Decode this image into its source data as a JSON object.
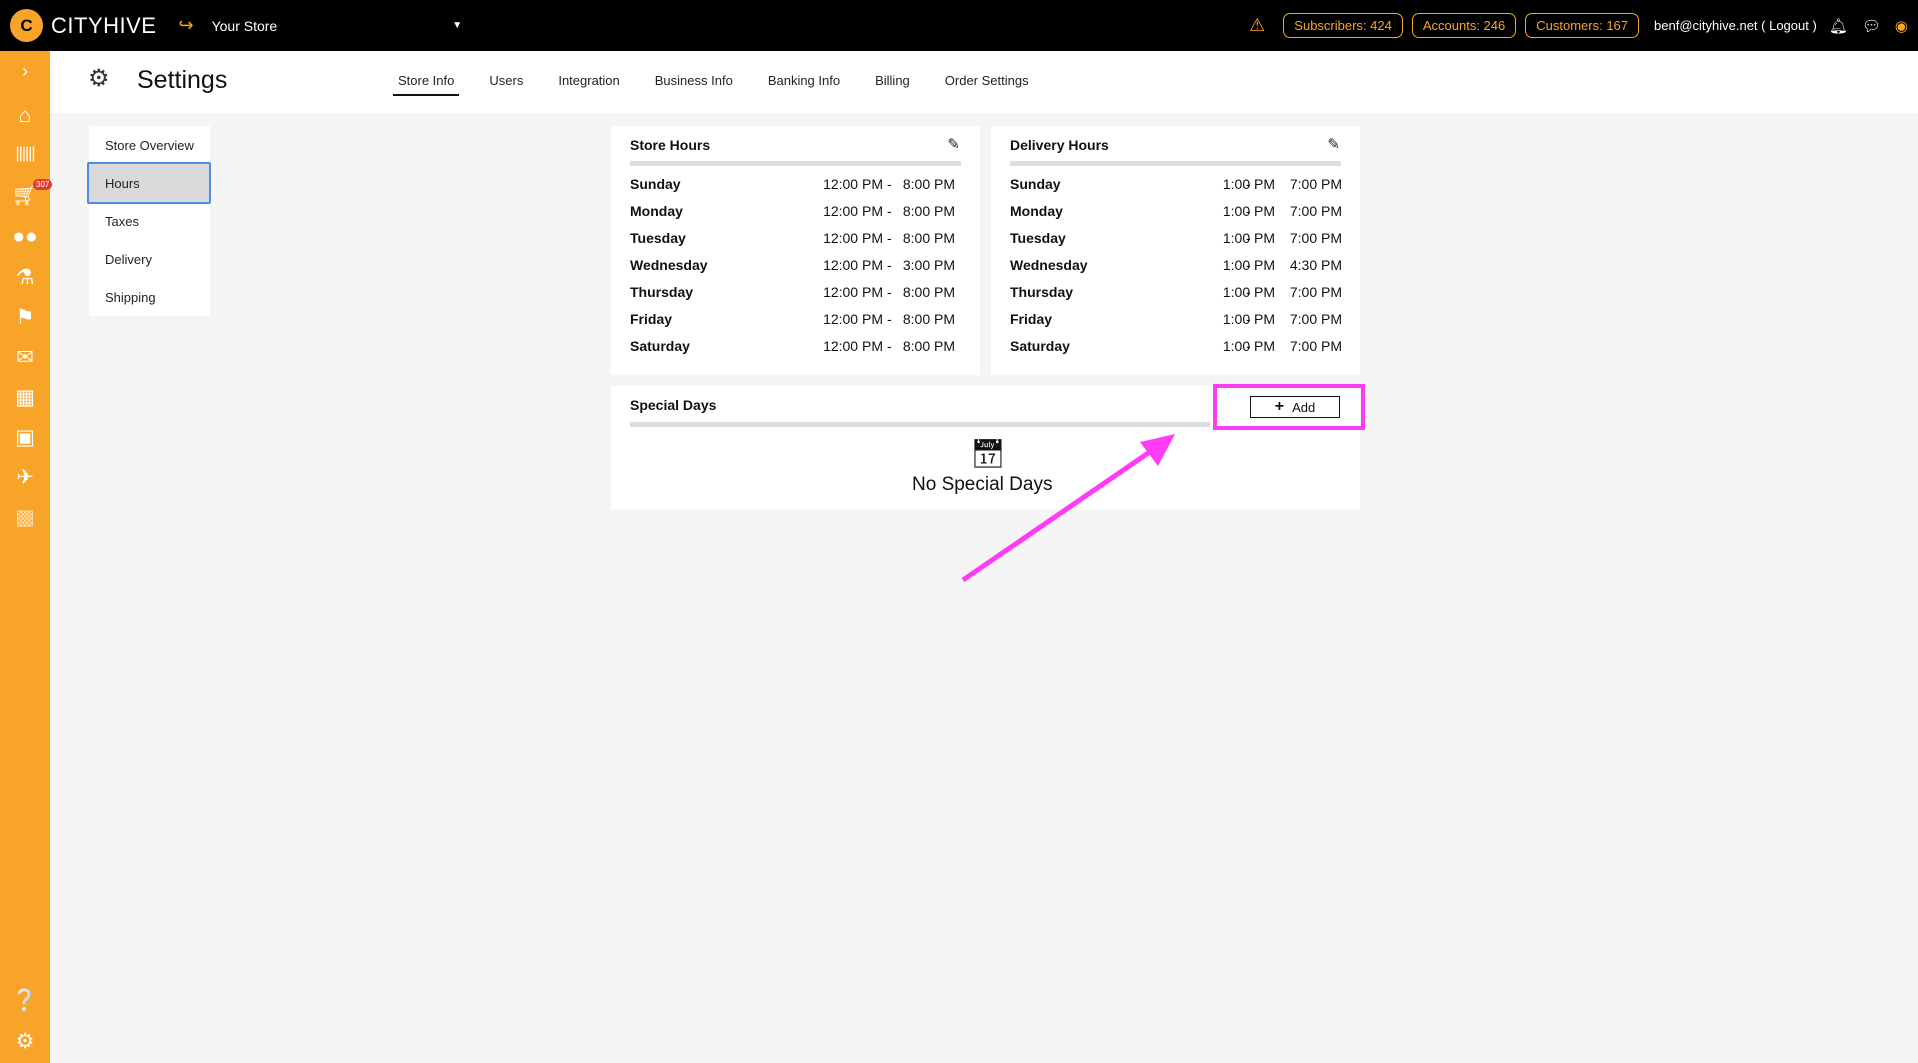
{
  "topbar": {
    "logo_glyph": "C",
    "brand": "CITYHIVE",
    "store_name": "Your Store",
    "pills": [
      "Subscribers: 424",
      "Accounts: 246",
      "Customers: 167"
    ],
    "user_email": "benf@cityhive.net ( Logout )",
    "accent_color": "#f7a428"
  },
  "sidebar": {
    "icons": [
      "chevron-right-icon",
      "home-icon",
      "barcode-icon",
      "cart-icon",
      "users-icon",
      "flask-icon",
      "tags-icon",
      "messages-icon",
      "calendar-icon",
      "book-icon",
      "plane-icon",
      "puzzle-icon",
      "help-icon",
      "gear-icon"
    ],
    "cart_badge": "307"
  },
  "header": {
    "title": "Settings",
    "tabs": [
      {
        "label": "Store Info",
        "active": true
      },
      {
        "label": "Users",
        "active": false
      },
      {
        "label": "Integration",
        "active": false
      },
      {
        "label": "Business Info",
        "active": false
      },
      {
        "label": "Banking Info",
        "active": false
      },
      {
        "label": "Billing",
        "active": false
      },
      {
        "label": "Order Settings",
        "active": false
      }
    ]
  },
  "leftmenu": {
    "items": [
      {
        "label": "Store Overview",
        "active": false
      },
      {
        "label": "Hours",
        "active": true
      },
      {
        "label": "Taxes",
        "active": false
      },
      {
        "label": "Delivery",
        "active": false
      },
      {
        "label": "Shipping",
        "active": false
      }
    ]
  },
  "store_hours": {
    "title": "Store Hours",
    "rows": [
      {
        "day": "Sunday",
        "open": "12:00 PM",
        "close": "8:00 PM"
      },
      {
        "day": "Monday",
        "open": "12:00 PM",
        "close": "8:00 PM"
      },
      {
        "day": "Tuesday",
        "open": "12:00 PM",
        "close": "8:00 PM"
      },
      {
        "day": "Wednesday",
        "open": "12:00 PM",
        "close": "3:00 PM"
      },
      {
        "day": "Thursday",
        "open": "12:00 PM",
        "close": "8:00 PM"
      },
      {
        "day": "Friday",
        "open": "12:00 PM",
        "close": "8:00 PM"
      },
      {
        "day": "Saturday",
        "open": "12:00 PM",
        "close": "8:00 PM"
      }
    ]
  },
  "delivery_hours": {
    "title": "Delivery Hours",
    "rows": [
      {
        "day": "Sunday",
        "open": "1:00 PM",
        "close": "7:00 PM"
      },
      {
        "day": "Monday",
        "open": "1:00 PM",
        "close": "7:00 PM"
      },
      {
        "day": "Tuesday",
        "open": "1:00 PM",
        "close": "7:00 PM"
      },
      {
        "day": "Wednesday",
        "open": "1:00 PM",
        "close": "4:30 PM"
      },
      {
        "day": "Thursday",
        "open": "1:00 PM",
        "close": "7:00 PM"
      },
      {
        "day": "Friday",
        "open": "1:00 PM",
        "close": "7:00 PM"
      },
      {
        "day": "Saturday",
        "open": "1:00 PM",
        "close": "7:00 PM"
      }
    ]
  },
  "special_days": {
    "title": "Special Days",
    "add_label": "Add",
    "empty_text": "No Special Days"
  },
  "annotation_color": "#ff3bf5",
  "dash": "-"
}
